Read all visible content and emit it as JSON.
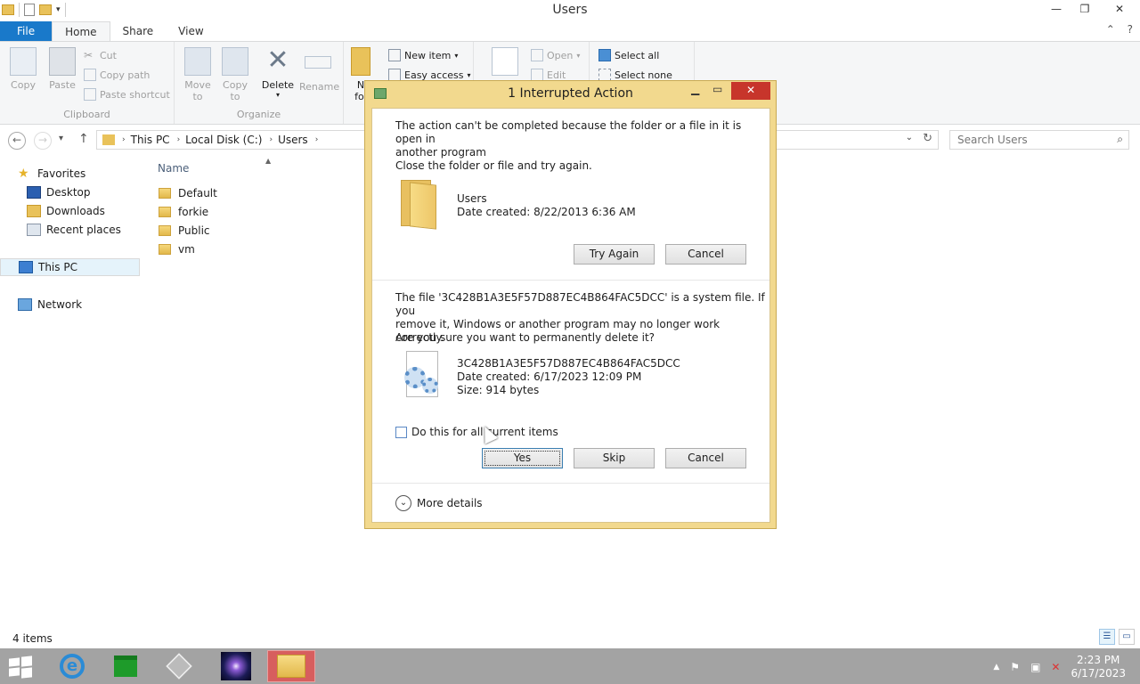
{
  "window": {
    "title": "Users",
    "minimize": "—",
    "maximize": "❐",
    "close": "✕"
  },
  "quick_access": {
    "dropdown": "▾"
  },
  "ribbon": {
    "tabs": [
      "File",
      "Home",
      "Share",
      "View"
    ],
    "collapse": "⌃",
    "help": "?",
    "clipboard": {
      "copy": "Copy",
      "paste": "Paste",
      "cut": "Cut",
      "copy_path": "Copy path",
      "paste_shortcut": "Paste shortcut",
      "label": "Clipboard"
    },
    "organize": {
      "move_to": "Move",
      "move_to2": "to",
      "copy_to": "Copy",
      "copy_to2": "to",
      "delete": "Delete",
      "rename": "Rename",
      "label": "Organize"
    },
    "new": {
      "new_folder_a": "N",
      "new_folder_b": "fol",
      "new_item": "New item",
      "easy_access": "Easy access"
    },
    "open": {
      "open": "Open",
      "edit": "Edit"
    },
    "select": {
      "select_all": "Select all",
      "select_none": "Select none"
    }
  },
  "address": {
    "back": "←",
    "forward": "→",
    "recent": "▾",
    "up": "↑",
    "crumbs": [
      "This PC",
      "Local Disk (C:)",
      "Users"
    ],
    "search_placeholder": "Search Users"
  },
  "nav_pane": {
    "favorites": "Favorites",
    "desktop": "Desktop",
    "downloads": "Downloads",
    "recent_places": "Recent places",
    "this_pc": "This PC",
    "network": "Network"
  },
  "file_list": {
    "column_name": "Name",
    "items": [
      "Default",
      "forkie",
      "Public",
      "vm"
    ]
  },
  "status": {
    "count": "4 items"
  },
  "dialog": {
    "title": "1 Interrupted Action",
    "msg1_line1": "The action can't be completed because the folder or a file in it is open in",
    "msg1_line2": "another program",
    "msg1_line3": "Close the folder or file and try again.",
    "folder_name": "Users",
    "folder_date": "Date created: 8/22/2013 6:36 AM",
    "try_again": "Try Again",
    "cancel1": "Cancel",
    "msg2_line1": "The file '3C428B1A3E5F57D887EC4B864FAC5DCC' is a system file. If you",
    "msg2_line2": "remove it, Windows or another program may no longer work correctly.",
    "msg2_line3": "Are you sure you want to permanently delete it?",
    "file_name": "3C428B1A3E5F57D887EC4B864FAC5DCC",
    "file_date": "Date created: 6/17/2023 12:09 PM",
    "file_size": "Size: 914 bytes",
    "checkbox_label": "Do this for all current items",
    "checkbox_checked": false,
    "yes": "Yes",
    "skip": "Skip",
    "cancel2": "Cancel",
    "more_details": "More details"
  },
  "taskbar": {
    "clock_time": "2:23 PM",
    "clock_date": "6/17/2023",
    "tray_up": "▲",
    "flag": "⚑",
    "network": "▣",
    "volume": "✕"
  },
  "colors": {
    "file_tab": "#1979ca",
    "dialog_frame": "#f2d98e",
    "close_red": "#c7352b",
    "taskbar": "#a3a3a3"
  }
}
